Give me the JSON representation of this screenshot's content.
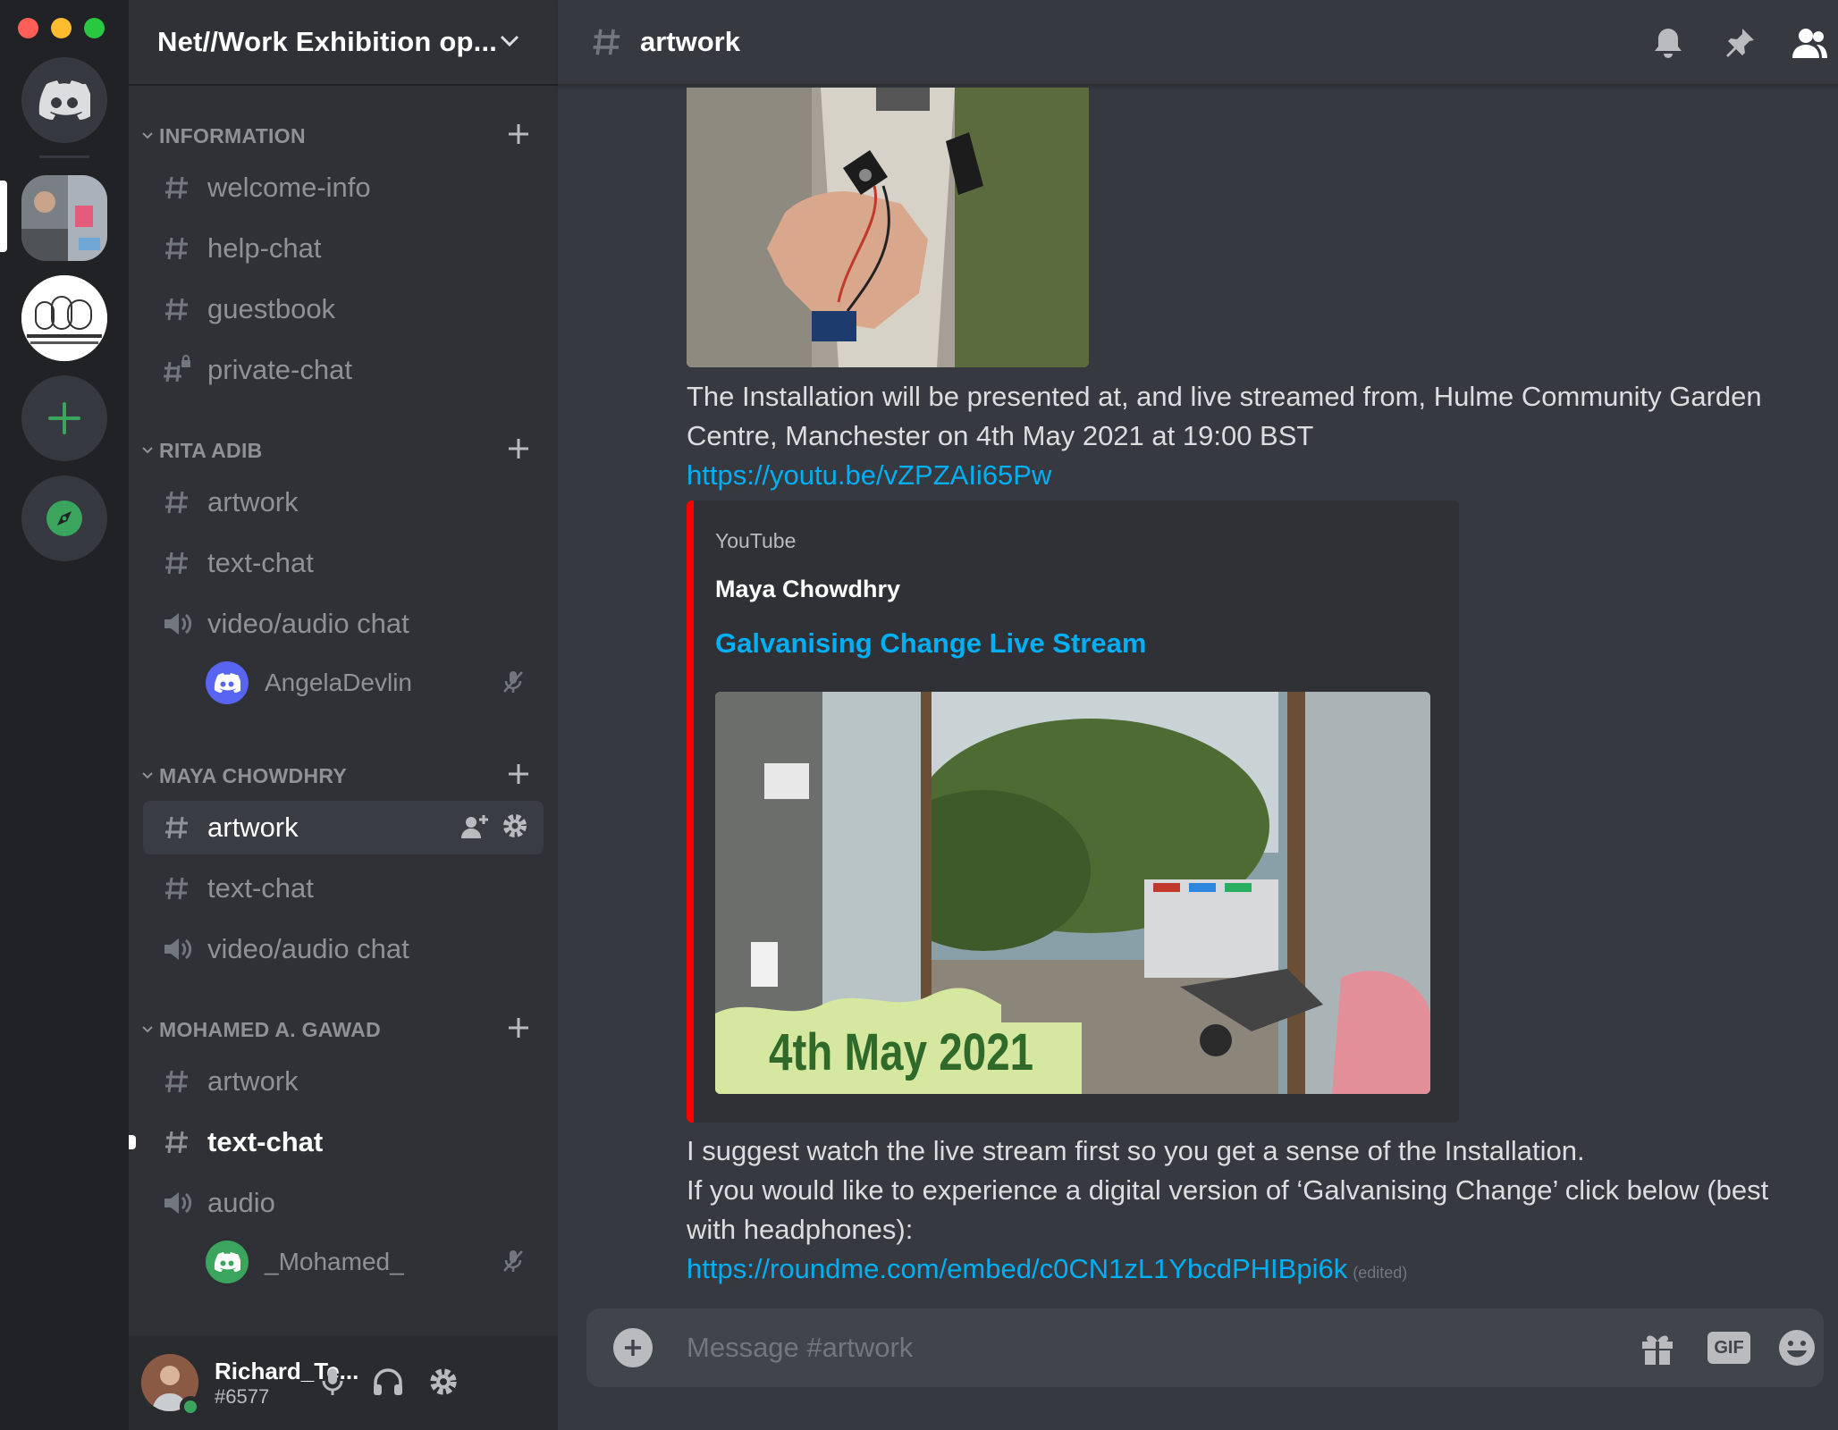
{
  "window": {
    "traffic_lights": {
      "close": "#ff5f57",
      "minimize": "#febc2e",
      "zoom": "#28c840"
    }
  },
  "colors": {
    "accent_blue": "#5865f2",
    "link": "#00aff4",
    "youtube_red": "#ff0000",
    "online_green": "#3ba55d"
  },
  "rail": {
    "servers": [
      {
        "name": "home",
        "icon": "discord-logo-icon"
      },
      {
        "name": "net-work-exhibition",
        "icon": "server-thumbnail",
        "selected": true
      },
      {
        "name": "digital-arts-studios",
        "icon": "digital-arts-studios-logo"
      },
      {
        "name": "add-server",
        "icon": "plus-icon"
      },
      {
        "name": "explore",
        "icon": "compass-icon"
      }
    ]
  },
  "guild": {
    "name": "Net//Work Exhibition op..."
  },
  "categories": [
    {
      "label": "INFORMATION",
      "channels": [
        {
          "type": "text",
          "label": "welcome-info"
        },
        {
          "type": "text",
          "label": "help-chat"
        },
        {
          "type": "text",
          "label": "guestbook"
        },
        {
          "type": "private",
          "label": "private-chat"
        }
      ]
    },
    {
      "label": "RITA ADIB",
      "channels": [
        {
          "type": "text",
          "label": "artwork"
        },
        {
          "type": "text",
          "label": "text-chat"
        },
        {
          "type": "voice",
          "label": "video/audio chat"
        }
      ],
      "voice_users": [
        {
          "name": "AngelaDevlin",
          "avatar_color": "#5865f2"
        }
      ]
    },
    {
      "label": "MAYA CHOWDHRY",
      "channels": [
        {
          "type": "text",
          "label": "artwork",
          "active": true
        },
        {
          "type": "text",
          "label": "text-chat"
        },
        {
          "type": "voice",
          "label": "video/audio chat"
        }
      ]
    },
    {
      "label": "MOHAMED A. GAWAD",
      "channels": [
        {
          "type": "text",
          "label": "artwork"
        },
        {
          "type": "text",
          "label": "text-chat",
          "unread": true
        },
        {
          "type": "voice",
          "label": "audio"
        }
      ],
      "voice_users": [
        {
          "name": "_Mohamed_",
          "avatar_color": "#3ba55d"
        }
      ]
    }
  ],
  "user": {
    "name": "Richard_Te...",
    "tag": "#6577",
    "status": "online"
  },
  "channel_header": {
    "title": "artwork"
  },
  "messages": {
    "line1": "The Installation will be presented at, and live streamed from, Hulme Community Garden",
    "line2": "Centre, Manchester on 4th May 2021 at 19:00 BST",
    "link1": "https://youtu.be/vZPZAIi65Pw",
    "embed": {
      "provider": "YouTube",
      "author": "Maya Chowdhry",
      "title": "Galvanising Change Live Stream",
      "thumbnail_caption": "4th May 2021"
    },
    "line3": "I suggest watch the live stream first so you get a sense of the Installation.",
    "line4": "If you would like to experience a digital version of ‘Galvanising Change’ click below (best",
    "line5": "with headphones):",
    "link2": "https://roundme.com/embed/c0CN1zL1YbcdPHIBpi6k",
    "edited": "(edited)"
  },
  "composer": {
    "placeholder": "Message #artwork",
    "gif_label": "GIF"
  }
}
